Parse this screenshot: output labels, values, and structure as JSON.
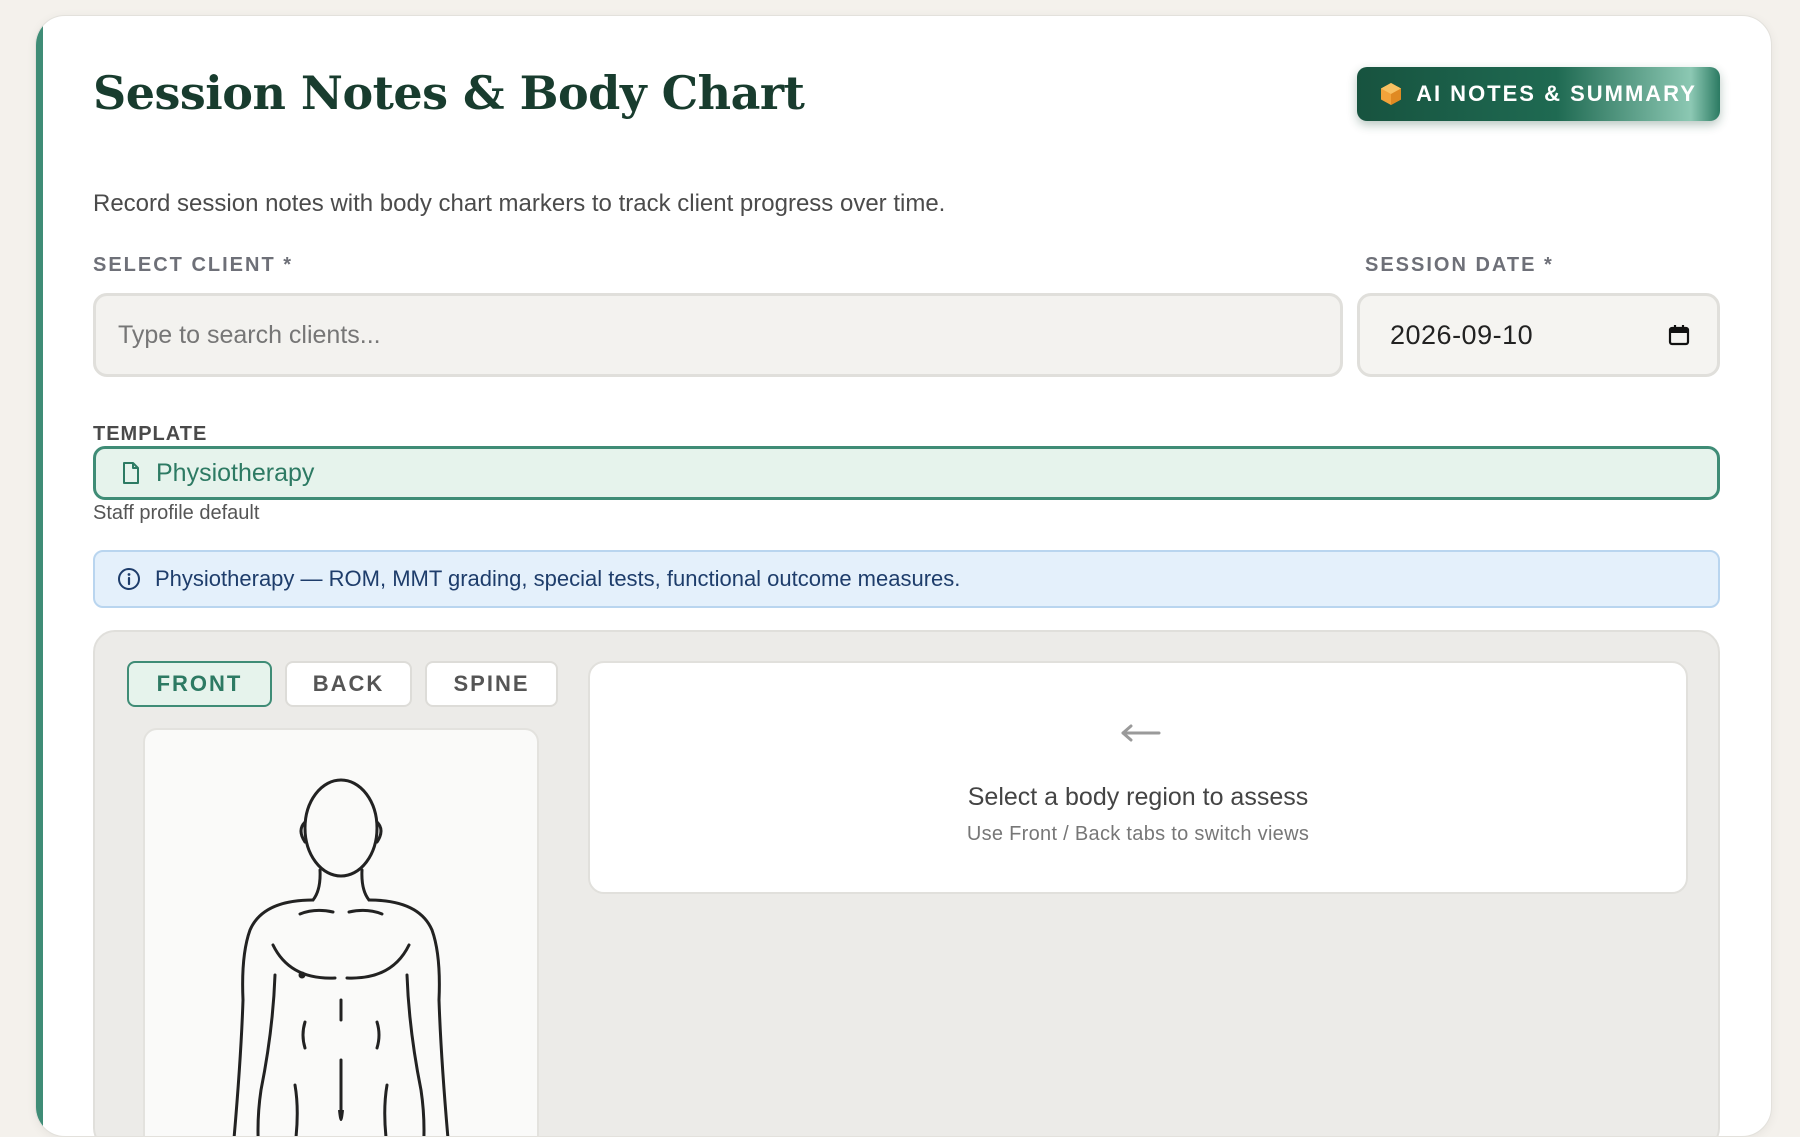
{
  "header": {
    "title": "Session Notes & Body Chart",
    "ai_button_label": "AI NOTES & SUMMARY",
    "subtitle": "Record session notes with body chart markers to track client progress over time."
  },
  "client": {
    "label": "SELECT CLIENT *",
    "placeholder": "Type to search clients...",
    "value": ""
  },
  "session_date": {
    "label": "SESSION DATE *",
    "value": "2026-09-10"
  },
  "template": {
    "label": "TEMPLATE",
    "value": "Physiotherapy",
    "hint": "Staff profile default"
  },
  "info_banner": {
    "text": "Physiotherapy — ROM, MMT grading, special tests, functional outcome measures."
  },
  "body_chart": {
    "tabs": [
      {
        "label": "FRONT",
        "active": true
      },
      {
        "label": "BACK",
        "active": false
      },
      {
        "label": "SPINE",
        "active": false
      }
    ],
    "empty_state": {
      "title": "Select a body region to assess",
      "hint": "Use Front / Back tabs to switch views"
    }
  },
  "colors": {
    "accent": "#3f8c76",
    "title": "#183c2e",
    "ai_button": "#17533f",
    "info_bg": "#e4f0fb",
    "hex_icon": "#f2a33a"
  },
  "icons": {
    "ai_button": "hexagon-icon",
    "date": "calendar-icon",
    "template": "document-icon",
    "banner": "info-icon",
    "empty_state": "arrow-left-icon"
  }
}
